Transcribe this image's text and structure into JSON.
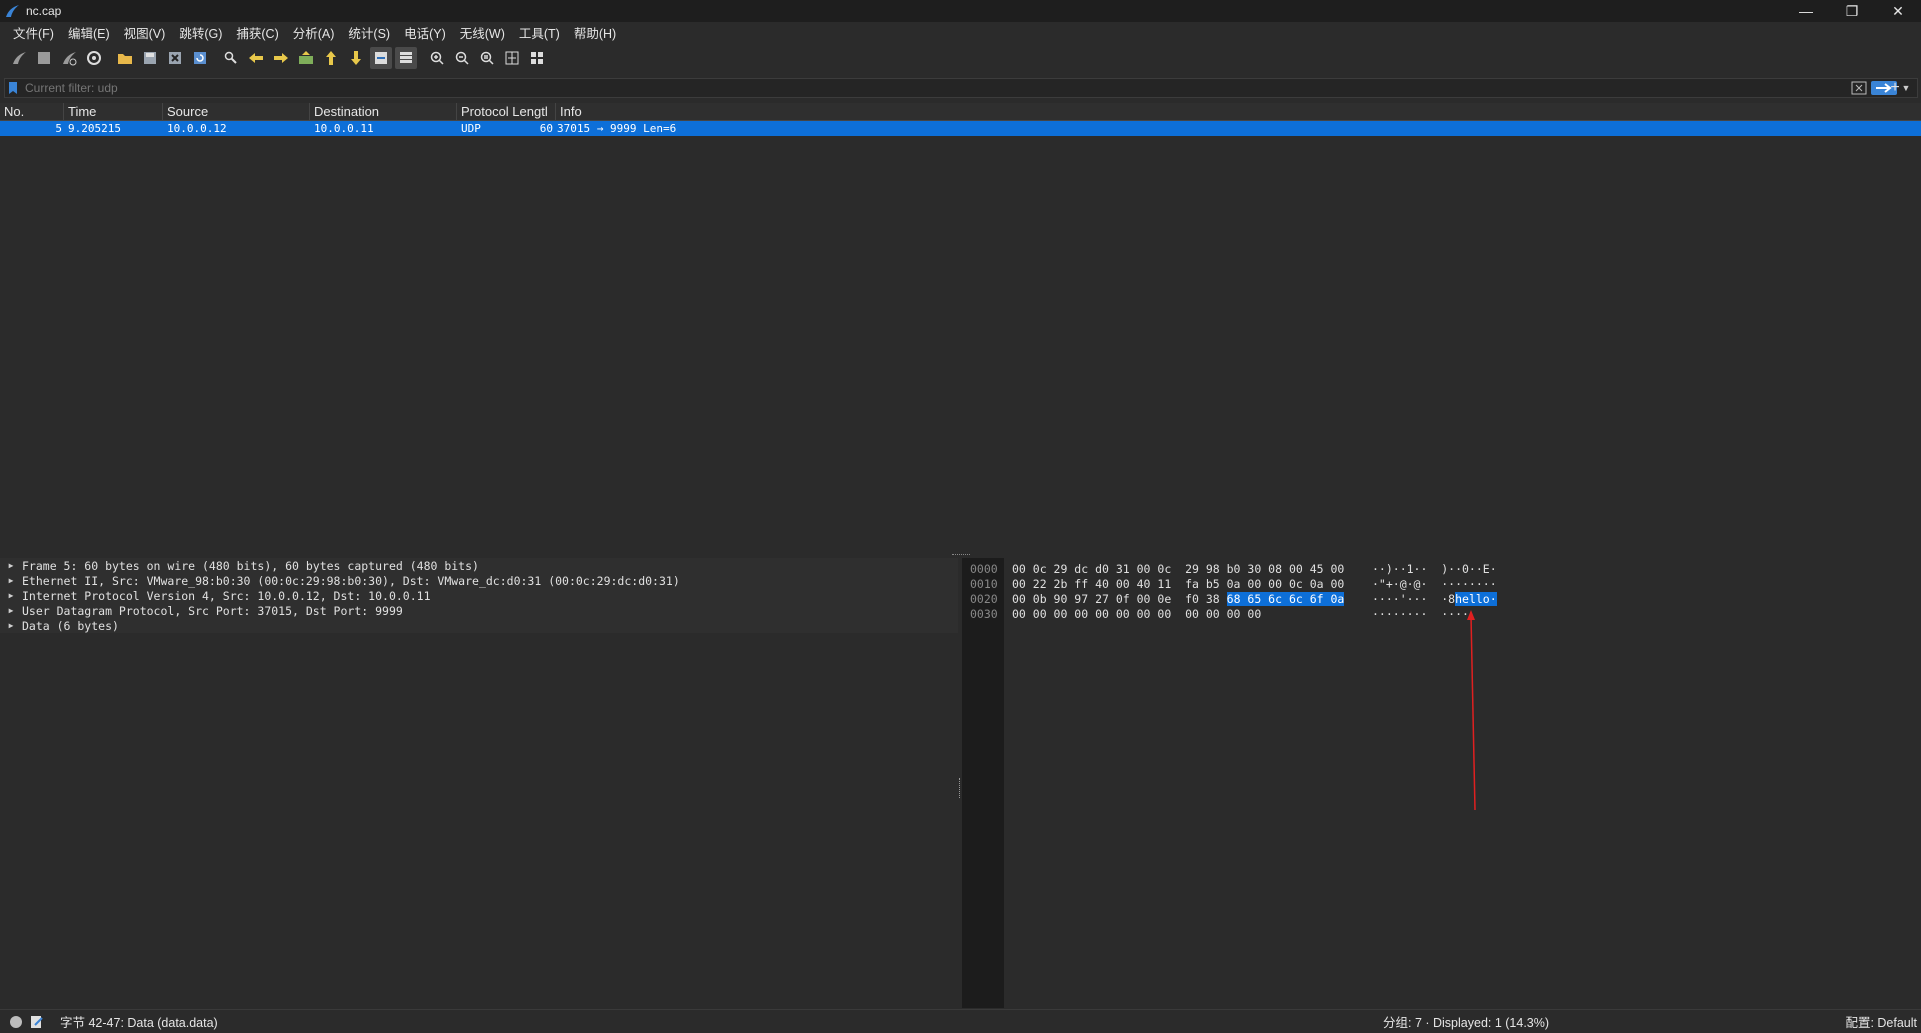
{
  "window": {
    "title": "nc.cap",
    "controls": {
      "minimize": "—",
      "maximize": "❐",
      "close": "✕"
    }
  },
  "menu": [
    "文件(F)",
    "编辑(E)",
    "视图(V)",
    "跳转(G)",
    "捕获(C)",
    "分析(A)",
    "统计(S)",
    "电话(Y)",
    "无线(W)",
    "工具(T)",
    "帮助(H)"
  ],
  "filter": {
    "placeholder": "Current filter: udp",
    "add_label": "+"
  },
  "packet_list": {
    "columns": [
      "No.",
      "Time",
      "Source",
      "Destination",
      "Protocol",
      "Length",
      "Info"
    ],
    "header_display": {
      "protocol_length": "Protocol Lengtl",
      "info": "Info"
    },
    "rows": [
      {
        "no": "5",
        "time": "9.205215",
        "source": "10.0.0.12",
        "destination": "10.0.0.11",
        "protocol": "UDP",
        "length": "60",
        "info": "37015 → 9999 Len=6"
      }
    ]
  },
  "details": [
    "Frame 5: 60 bytes on wire (480 bits), 60 bytes captured (480 bits)",
    "Ethernet II, Src: VMware_98:b0:30 (00:0c:29:98:b0:30), Dst: VMware_dc:d0:31 (00:0c:29:dc:d0:31)",
    "Internet Protocol Version 4, Src: 10.0.0.12, Dst: 10.0.0.11",
    "User Datagram Protocol, Src Port: 37015, Dst Port: 9999",
    "Data (6 bytes)"
  ],
  "bytes": [
    {
      "offset": "0000",
      "hex": "00 0c 29 dc d0 31 00 0c  29 98 b0 30 08 00 45 00",
      "hex_hl": "",
      "ascii": "··)··1··  )··0··E·",
      "ascii_hl": ""
    },
    {
      "offset": "0010",
      "hex": "00 22 2b ff 40 00 40 11  fa b5 0a 00 00 0c 0a 00",
      "hex_hl": "",
      "ascii": "·\"+·@·@·  ········",
      "ascii_hl": ""
    },
    {
      "offset": "0020",
      "hex": "00 0b 90 97 27 0f 00 0e  f0 38 ",
      "hex_hl": "68 65 6c 6c 6f 0a",
      "ascii": "····'···  ·8",
      "ascii_hl": "hello·"
    },
    {
      "offset": "0030",
      "hex": "00 00 00 00 00 00 00 00  00 00 00 00",
      "hex_hl": "",
      "ascii": "········  ····",
      "ascii_hl": ""
    }
  ],
  "status": {
    "left": "字节 42-47: Data (data.data)",
    "middle": "分组: 7 · Displayed: 1 (14.3%)",
    "right": "配置: Default"
  },
  "colors": {
    "selection": "#0d6fd8",
    "annotation_arrow": "#e02020",
    "background": "#2b2b2b"
  }
}
